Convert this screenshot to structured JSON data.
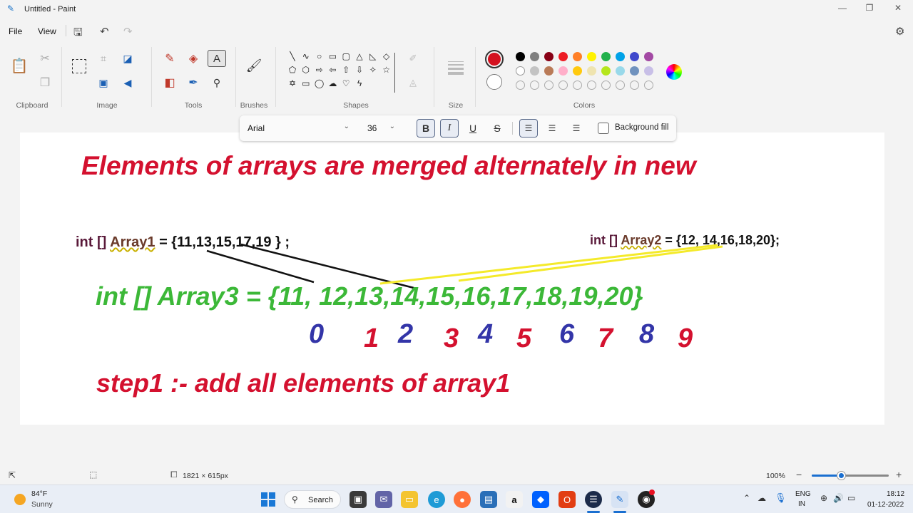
{
  "window": {
    "title": "Untitled - Paint",
    "min": "—",
    "max": "❐",
    "close": "✕"
  },
  "menu": {
    "file": "File",
    "view": "View"
  },
  "ribbon": {
    "groups": {
      "clipboard": "Clipboard",
      "image": "Image",
      "tools": "Tools",
      "brushes": "Brushes",
      "shapes": "Shapes",
      "size": "Size",
      "colors": "Colors"
    },
    "shapes_glyphs": [
      "╲",
      "∿",
      "○",
      "▭",
      "▢",
      "△",
      "◺",
      "◇",
      "⬠",
      "⬡",
      "⇨",
      "⇦",
      "⇧",
      "⇩",
      "✧",
      "☆",
      "✡",
      "▭",
      "◯",
      "☁",
      "♡",
      "ϟ"
    ],
    "primary_color": "#d4111f",
    "secondary_color": "#ffffff",
    "palette_row1": [
      "#000000",
      "#7f7f7f",
      "#880015",
      "#ed1c24",
      "#ff7f27",
      "#fff200",
      "#22b14c",
      "#00a2e8",
      "#3f48cc",
      "#a349a4"
    ],
    "palette_row2": [
      "#ffffff",
      "#c3c3c3",
      "#b97a57",
      "#ffaec9",
      "#ffc90e",
      "#efe4b0",
      "#b5e61d",
      "#99d9ea",
      "#7092be",
      "#c8bfe7"
    ]
  },
  "textbar": {
    "font": "Arial",
    "size": "36",
    "bold": "B",
    "italic": "I",
    "underline": "U",
    "strike": "S",
    "background_fill": "Background fill"
  },
  "canvas": {
    "heading": "Elements of arrays are merged alternately in new",
    "array1": {
      "kw": "int [] ",
      "name": "Array1",
      "rest": " = {11,13,15,17,19 } ;"
    },
    "array2": {
      "kw": "int [] ",
      "name": "Array2",
      "rest": " = {12, 14,16,18,20};"
    },
    "array3": "int [] Array3 = {11, 12,13,14,15,16,17,18,19,20}",
    "indices": [
      "0",
      "1",
      "2",
      "3",
      "4",
      "5",
      "6",
      "7",
      "8",
      "9"
    ],
    "step": "step1 :- add all elements of array1"
  },
  "status": {
    "dimensions": "1821 × 615px",
    "zoom": "100%"
  },
  "taskbar": {
    "weather_temp": "84°F",
    "weather_desc": "Sunny",
    "search": "Search",
    "lang1": "ENG",
    "lang2": "IN",
    "time": "18:12",
    "date": "01-12-2022"
  }
}
